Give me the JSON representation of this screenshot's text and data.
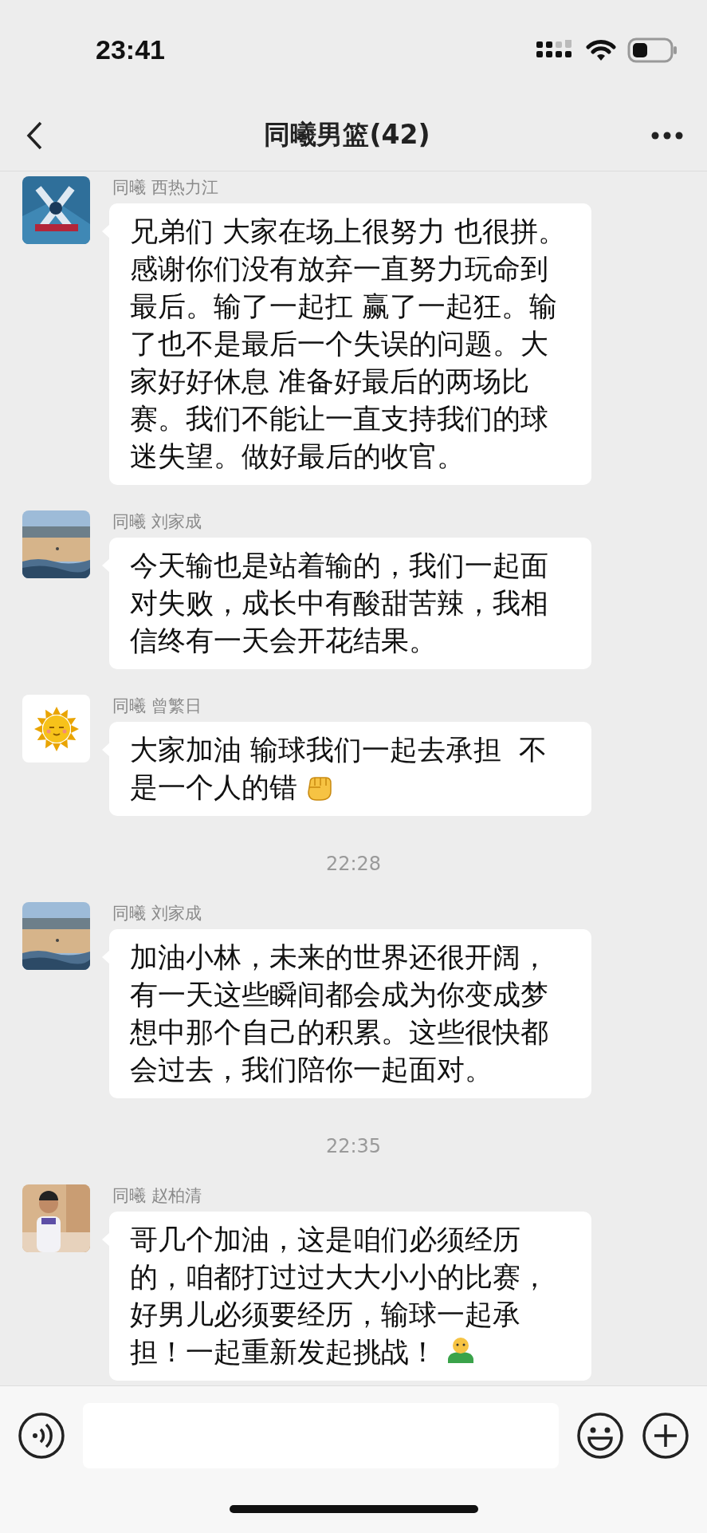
{
  "status_bar": {
    "time": "23:41"
  },
  "header": {
    "title": "同曦男篮(42)"
  },
  "messages": [
    {
      "kind": "message",
      "sender": "同曦 西热力江",
      "avatar": {
        "kind": "emblem"
      },
      "text": "兄弟们 大家在场上很努力 也很拼。感谢你们没有放弃一直努力玩命到最后。输了一起扛 赢了一起狂。输了也不是最后一个失误的问题。大家好好休息 准备好最后的两场比赛。我们不能让一直支持我们的球迷失望。做好最后的收官。"
    },
    {
      "kind": "message",
      "sender": "同曦 刘家成",
      "avatar": {
        "kind": "beach"
      },
      "text": "今天输也是站着输的，我们一起面对失败，成长中有酸甜苦辣，我相信终有一天会开花结果。"
    },
    {
      "kind": "message",
      "sender": "同曦 曾繁日",
      "avatar": {
        "kind": "sun"
      },
      "text": "大家加油 输球我们一起去承担  不是一个人的错",
      "emoji": {
        "kind": "fist"
      }
    },
    {
      "kind": "time",
      "text": "22:28"
    },
    {
      "kind": "message",
      "sender": "同曦 刘家成",
      "avatar": {
        "kind": "beach"
      },
      "text": "加油小林，未来的世界还很开阔，有一天这些瞬间都会成为你变成梦想中那个自己的积累。这些很快都会过去，我们陪你一起面对。"
    },
    {
      "kind": "time",
      "text": "22:35"
    },
    {
      "kind": "message",
      "sender": "同曦 赵柏清",
      "avatar": {
        "kind": "person"
      },
      "text": "哥几个加油，这是咱们必须经历的，咱都打过过大大小小的比赛，好男儿必须要经历，输球一起承担！一起重新发起挑战！",
      "emoji": {
        "kind": "figure"
      }
    }
  ]
}
